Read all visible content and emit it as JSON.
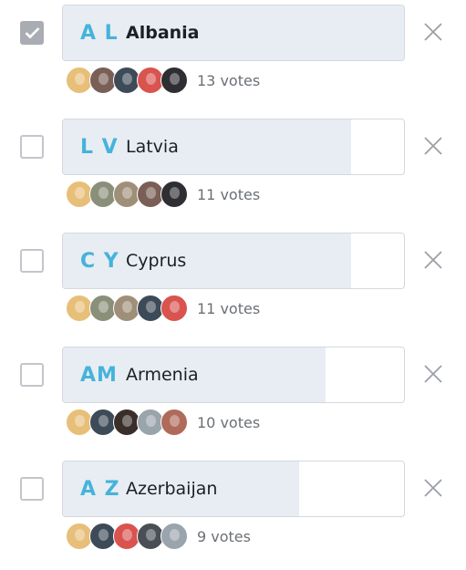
{
  "options": [
    {
      "code": "A L",
      "name": "Albania",
      "votes_label": "13 votes",
      "votes": 13,
      "checked": true,
      "voter_avatars": [
        "person-avatar",
        "person-avatar",
        "person-avatar",
        "person-avatar",
        "person-avatar"
      ]
    },
    {
      "code": "L V",
      "name": "Latvia",
      "votes_label": "11 votes",
      "votes": 11,
      "checked": false,
      "voter_avatars": [
        "person-avatar",
        "person-avatar",
        "person-avatar",
        "person-avatar",
        "person-avatar"
      ]
    },
    {
      "code": "C Y",
      "name": "Cyprus",
      "votes_label": "11 votes",
      "votes": 11,
      "checked": false,
      "voter_avatars": [
        "person-avatar",
        "person-avatar",
        "person-avatar",
        "person-avatar",
        "person-avatar"
      ]
    },
    {
      "code": "AM",
      "name": "Armenia",
      "votes_label": "10 votes",
      "votes": 10,
      "checked": false,
      "voter_avatars": [
        "person-avatar",
        "person-avatar",
        "person-avatar",
        "person-avatar",
        "person-avatar"
      ]
    },
    {
      "code": "A Z",
      "name": "Azerbaijan",
      "votes_label": "9 votes",
      "votes": 9,
      "checked": false,
      "voter_avatars": [
        "person-avatar",
        "person-avatar",
        "person-avatar",
        "person-avatar",
        "person-avatar"
      ]
    }
  ],
  "icons": {
    "checkbox_checked": "check-icon",
    "remove": "close-icon"
  },
  "colors": {
    "accent": "#45b3da",
    "bar_fill": "#e8edf3",
    "bar_border": "#d4d8de",
    "checkbox_checked": "#a9adb3",
    "checkbox_border": "#c2c6cc",
    "remove_icon": "#9aa0a6",
    "votes_text": "#6b7075"
  }
}
